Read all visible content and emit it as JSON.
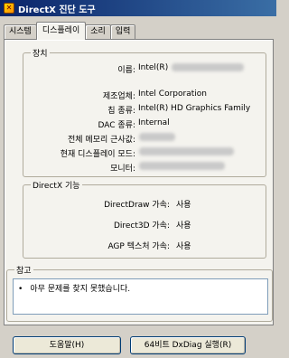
{
  "window": {
    "title": "DirectX 진단 도구"
  },
  "tabs": [
    {
      "label": "시스템"
    },
    {
      "label": "디스플레이"
    },
    {
      "label": "소리"
    },
    {
      "label": "입력"
    }
  ],
  "device": {
    "legend": "장치",
    "rows": [
      {
        "label": "이름:",
        "value": "Intel(R)"
      },
      {
        "label": "제조업체:",
        "value": "Intel Corporation"
      },
      {
        "label": "칩 종류:",
        "value": "Intel(R) HD Graphics Family"
      },
      {
        "label": "DAC 종류:",
        "value": "Internal"
      },
      {
        "label": "전체 메모리 근사값:",
        "value": ""
      },
      {
        "label": "현재 디스플레이 모드:",
        "value": ""
      },
      {
        "label": "모니터:",
        "value": ""
      }
    ]
  },
  "directx": {
    "legend": "DirectX 기능",
    "rows": [
      {
        "label": "DirectDraw 가속:",
        "value": "사용"
      },
      {
        "label": "Direct3D 가속:",
        "value": "사용"
      },
      {
        "label": "AGP 텍스처 가속:",
        "value": "사용"
      }
    ]
  },
  "notes": {
    "legend": "참고",
    "bullet": "•",
    "text": "아무 문제를 찾지 못했습니다."
  },
  "buttons": {
    "help": "도움말(H)",
    "dxdiag64": "64비트 DxDiag 실행(R)"
  }
}
